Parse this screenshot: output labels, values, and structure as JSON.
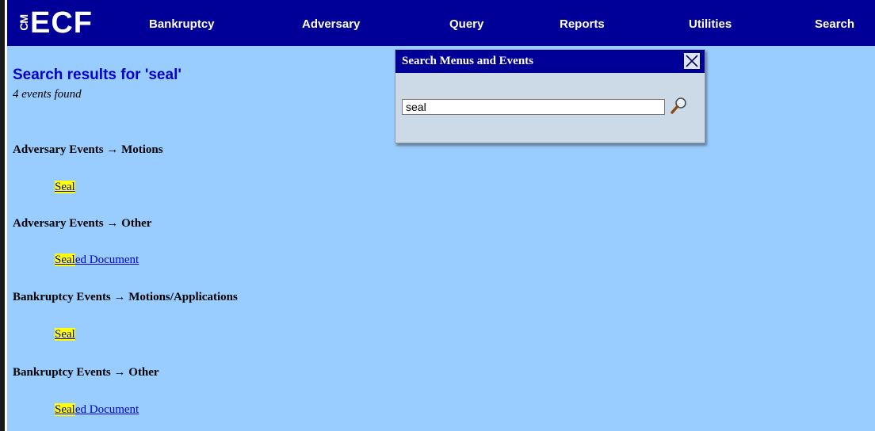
{
  "app": {
    "logo_prefix": "CM",
    "logo_main": "ECF"
  },
  "nav": {
    "items": [
      {
        "label": "Bankruptcy"
      },
      {
        "label": "Adversary"
      },
      {
        "label": "Query"
      },
      {
        "label": "Reports"
      },
      {
        "label": "Utilities"
      },
      {
        "label": "Search"
      }
    ]
  },
  "results": {
    "title": "Search results for 'seal'",
    "count": "4 events found",
    "sections": [
      {
        "heading": "Adversary Events → Motions",
        "link_match": "Seal",
        "link_rest": ""
      },
      {
        "heading": "Adversary Events → Other",
        "link_match": "Seal",
        "link_rest": "ed Document"
      },
      {
        "heading": "Bankruptcy Events → Motions/Applications",
        "link_match": "Seal",
        "link_rest": ""
      },
      {
        "heading": "Bankruptcy Events → Other",
        "link_match": "Seal",
        "link_rest": "ed Document"
      }
    ]
  },
  "dialog": {
    "title": "Search Menus and Events",
    "input_value": "seal"
  },
  "colors": {
    "background": "#99ccff",
    "nav_bar": "#000099",
    "highlight": "#ffff00",
    "link": "#0000cc"
  },
  "icons": {
    "close": "close-icon",
    "search": "magnifier-icon"
  }
}
